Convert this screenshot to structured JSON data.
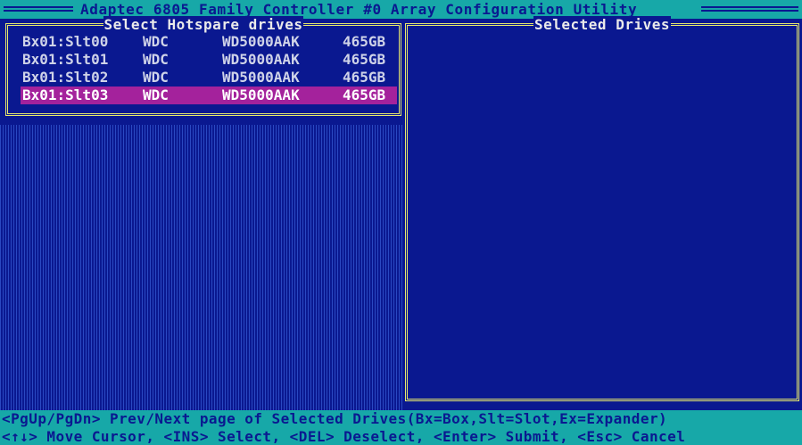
{
  "window": {
    "title": "Adaptec 6805 Family Controller #0 Array Configuration Utility"
  },
  "left_panel": {
    "title": "Select Hotspare drives",
    "drives": [
      {
        "location": "Bx01:Slt00",
        "vendor": "WDC",
        "model": "WD5000AAK",
        "size": "465GB",
        "selected": false
      },
      {
        "location": "Bx01:Slt01",
        "vendor": "WDC",
        "model": "WD5000AAK",
        "size": "465GB",
        "selected": false
      },
      {
        "location": "Bx01:Slt02",
        "vendor": "WDC",
        "model": "WD5000AAK",
        "size": "465GB",
        "selected": false
      },
      {
        "location": "Bx01:Slt03",
        "vendor": "WDC",
        "model": "WD5000AAK",
        "size": "465GB",
        "selected": true
      }
    ]
  },
  "right_panel": {
    "title": "Selected Drives"
  },
  "footer": {
    "line1": "<PgUp/PgDn> Prev/Next page of Selected Drives(Bx=Box,Slt=Slot,Ex=Expander)",
    "line2": "<↑↓> Move Cursor, <INS> Select, <DEL> Deselect, <Enter> Submit, <Esc> Cancel"
  },
  "colors": {
    "background": "#0a1890",
    "bar": "#17a8a8",
    "border": "#e8e86c",
    "highlight": "#a4229c"
  }
}
